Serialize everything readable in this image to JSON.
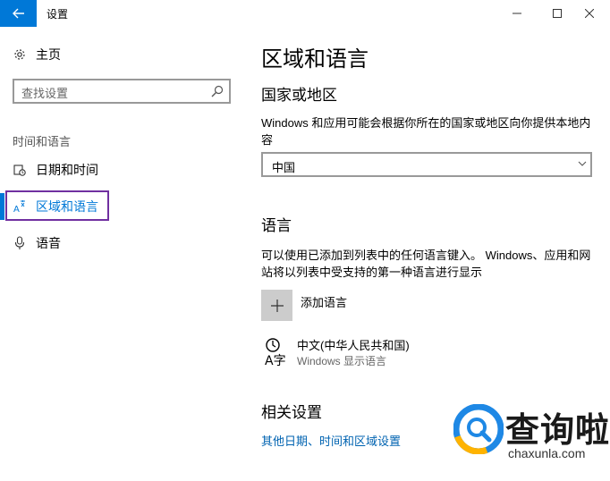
{
  "window": {
    "title": "设置",
    "controls": [
      "minimize-icon",
      "maximize-icon",
      "close-icon"
    ],
    "accent": "#0078d7"
  },
  "sidebar": {
    "home_label": "主页",
    "search_placeholder": "查找设置",
    "section_heading": "时间和语言",
    "items": [
      {
        "label": "日期和时间",
        "icon": "clock-calendar-icon",
        "active": false
      },
      {
        "label": "区域和语言",
        "icon": "region-language-icon",
        "active": true
      },
      {
        "label": "语音",
        "icon": "microphone-icon",
        "active": false
      }
    ]
  },
  "main": {
    "title": "区域和语言",
    "country": {
      "heading": "国家或地区",
      "description": "Windows 和应用可能会根据你所在的国家或地区向你提供本地内容",
      "selected": "中国"
    },
    "language": {
      "heading": "语言",
      "description": "可以使用已添加到列表中的任何语言键入。 Windows、应用和网站将以列表中受支持的第一种语言进行显示",
      "add_label": "添加语言",
      "entries": [
        {
          "name": "中文(中华人民共和国)",
          "sub": "Windows 显示语言"
        }
      ]
    },
    "related": {
      "heading": "相关设置",
      "link": "其他日期、时间和区域设置"
    }
  },
  "watermark": {
    "text": "查询啦",
    "url": "chaxunla.com"
  }
}
